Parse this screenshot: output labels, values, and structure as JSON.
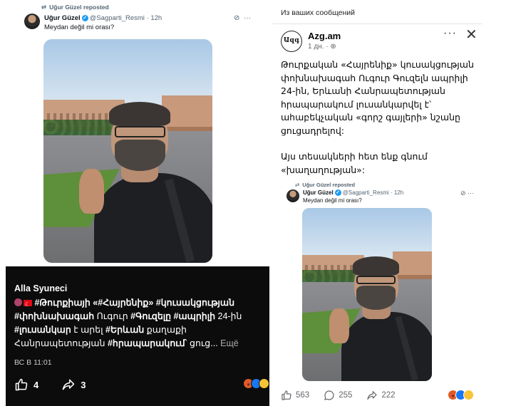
{
  "tweet": {
    "repost_label": "Uğur Güzel reposted",
    "name": "Uğur Güzel",
    "handle_time": "@Sagparti_Resmi · 12h",
    "text": "Meydan değil mi orası?"
  },
  "dark_post": {
    "author": "Alla Syuneci",
    "text_lead": "#Թուրքիայի «#Հայրենիք» #կուսակցության #փոխնախագահ",
    "text_mid1": " Ուգուր ",
    "text_tag2": "#Գուզելը #ապրիլի",
    "text_mid2": " 24-ին ",
    "text_tag3": "#լուսանկար",
    "text_mid3": " է արել ",
    "text_tag4": "#Երևան",
    "text_mid4": " քաղաքի Հանրապետության ",
    "text_tag5": "#հրապարակում",
    "text_tail": "՝ ցուց...",
    "more_label": "Ещё",
    "timestamp": "ВС В 11:01",
    "likes": "4",
    "shares": "3"
  },
  "fb_post": {
    "header": "Из ваших сообщений",
    "page_name": "Azg.am",
    "page_logo_text": "Ազգ",
    "meta": "1 дн. ·",
    "paragraph1": "Թուրքական «Հայրենիք» կուսակցության փոխնախագահ Ուգուր Գուզելն ապրիլի 24-ին, Երևանի Հանրապետության հրապարակում լուսանկարվել է՝ ահաբեկչական «գորշ գայլերի» նշանը ցուցադրելով:",
    "paragraph2": "Այս տեսակների հետ ենք գնում «խաղաղության»:",
    "likes": "563",
    "comments": "255",
    "shares": "222"
  },
  "colors": {
    "verified": "#1d9bf0",
    "dark_bg": "#0c0c0c",
    "fb_like": "#1877f2"
  }
}
